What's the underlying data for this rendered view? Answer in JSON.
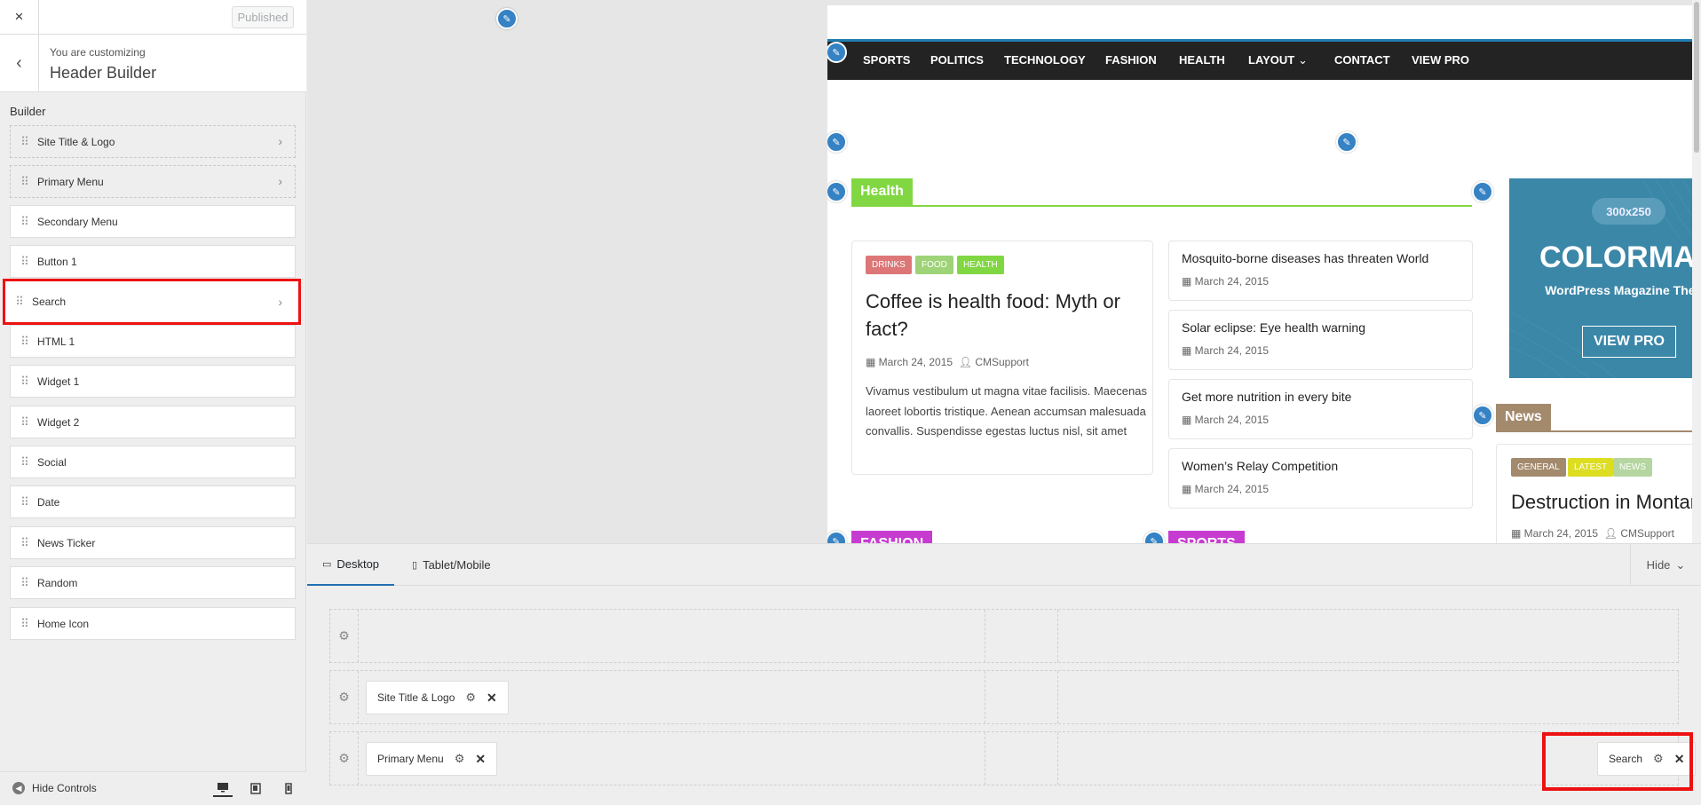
{
  "sidebar": {
    "close_icon": "×",
    "published_label": "Published",
    "back_icon": "‹",
    "customizing_label": "You are customizing",
    "section_title": "Header Builder",
    "builder_label": "Builder",
    "items": [
      {
        "label": "Site Title & Logo"
      },
      {
        "label": "Primary Menu"
      },
      {
        "label": "Secondary Menu"
      },
      {
        "label": "Button 1"
      },
      {
        "label": "Search"
      },
      {
        "label": "HTML 1"
      },
      {
        "label": "Widget 1"
      },
      {
        "label": "Widget 2"
      },
      {
        "label": "Social"
      },
      {
        "label": "Date"
      },
      {
        "label": "News Ticker"
      },
      {
        "label": "Random"
      },
      {
        "label": "Home Icon"
      }
    ],
    "hide_controls_label": "Hide Controls"
  },
  "preview": {
    "nav": [
      "SPORTS",
      "POLITICS",
      "TECHNOLOGY",
      "FASHION",
      "HEALTH",
      "LAYOUT",
      "CONTACT",
      "VIEW PRO"
    ],
    "health_title": "Health",
    "main_post": {
      "tags": [
        "DRINKS",
        "FOOD",
        "HEALTH"
      ],
      "title": "Coffee is health food: Myth or fact?",
      "date": "March 24, 2015",
      "author": "CMSupport",
      "excerpt": "Vivamus vestibulum ut magna vitae facilisis. Maecenas laoreet lobortis tristique. Aenean accumsan malesuada convallis. Suspendisse egestas luctus nisl, sit amet"
    },
    "side_posts": [
      {
        "title": "Mosquito-borne diseases has threaten World",
        "date": "March 24, 2015"
      },
      {
        "title": "Solar eclipse: Eye health warning",
        "date": "March 24, 2015"
      },
      {
        "title": "Get more nutrition in every bite",
        "date": "March 24, 2015"
      },
      {
        "title": "Women’s Relay Competition",
        "date": "March 24, 2015"
      }
    ],
    "ad": {
      "size": "300x250",
      "brand": "COLORMAG",
      "tagline": "WordPress Magazine Theme",
      "button": "VIEW PRO"
    },
    "news_title": "News",
    "news_post": {
      "tags": [
        "GENERAL",
        "LATEST",
        "NEWS"
      ],
      "title": "Destruction in Montania",
      "date": "March 24, 2015",
      "author": "CMSupport"
    },
    "fashion_title": "FASHION",
    "sports_title": "SPORTS"
  },
  "builder": {
    "tab_desktop": "Desktop",
    "tab_tablet": "Tablet/Mobile",
    "hide_label": "Hide",
    "row2_chip": "Site Title & Logo",
    "row3_chip": "Primary Menu",
    "row3_right_chip": "Search"
  },
  "colors": {
    "accent": "#207daf",
    "health": "#81d742",
    "news": "#a38a6d",
    "fashion": "#c73cd0",
    "highlight": "#ee1111"
  }
}
